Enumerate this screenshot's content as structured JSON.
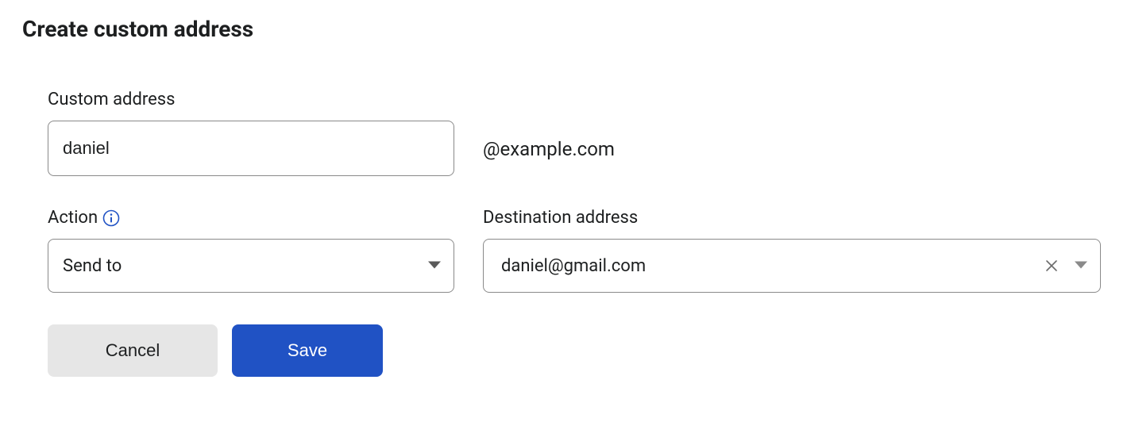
{
  "title": "Create custom address",
  "custom_address": {
    "label": "Custom address",
    "value": "daniel",
    "domain_suffix": "@example.com"
  },
  "action": {
    "label": "Action",
    "value": "Send to"
  },
  "destination": {
    "label": "Destination address",
    "value": "daniel@gmail.com"
  },
  "buttons": {
    "cancel": "Cancel",
    "save": "Save"
  }
}
